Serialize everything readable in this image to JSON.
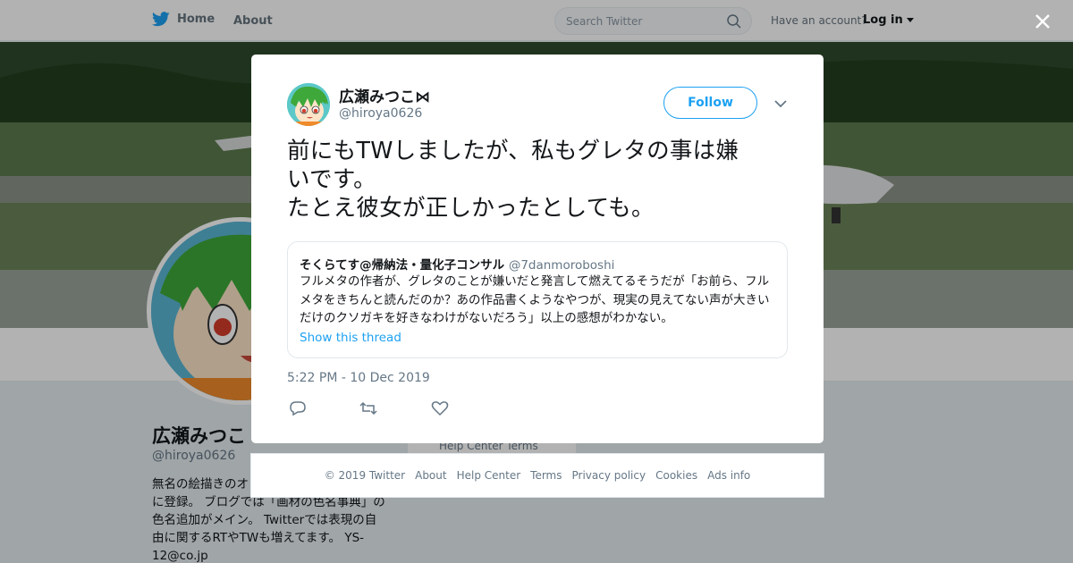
{
  "header": {
    "home_label": "Home",
    "about_label": "About",
    "search_placeholder": "Search Twitter",
    "have_account": "Have an account?",
    "login_label": "Log in"
  },
  "profile": {
    "name": "広瀬みつこ",
    "handle": "@hiroya0626",
    "bio": "無名の絵描きのオ pixiv、TINAMI、PIXTAに登録。 ブログでは「画材の色名事典」の色名追加がメイン。 Twitterでは表現の自由に関するRTやTWも増えてます。 YS-12@co.jp",
    "side_links": "Help Center   Terms"
  },
  "tweet": {
    "author_name": "広瀬みつこ⋈",
    "author_handle": "@hiroya0626",
    "follow_label": "Follow",
    "text_lines": [
      "前にもTWしましたが、私もグレタの事は嫌",
      "いです。",
      "たとえ彼女が正しかったとしても。"
    ],
    "quote": {
      "author_name": "そくらてす@帰納法・量化子コンサル",
      "author_handle": "@7danmoroboshi",
      "text": "フルメタの作者が、グレタのことが嫌いだと発言して燃えてるそうだが「お前ら、フルメタをきちんと読んだのか？あの作品書くようなやつが、現実の見えてない声が大きいだけのクソガキを好きなわけがないだろう」以上の感想がわかない。",
      "show_thread": "Show this thread"
    },
    "timestamp": "5:22 PM - 10 Dec 2019"
  },
  "footer": {
    "links": [
      "© 2019 Twitter",
      "About",
      "Help Center",
      "Terms",
      "Privacy policy",
      "Cookies",
      "Ads info"
    ]
  },
  "colors": {
    "accent": "#1da1f2",
    "secondary_text": "#657786",
    "overlay": "rgba(0,0,0,0.30)"
  },
  "icons": [
    "twitter-bird-icon",
    "search-icon",
    "caret-down-icon",
    "close-icon",
    "reply-icon",
    "retweet-icon",
    "like-icon"
  ]
}
